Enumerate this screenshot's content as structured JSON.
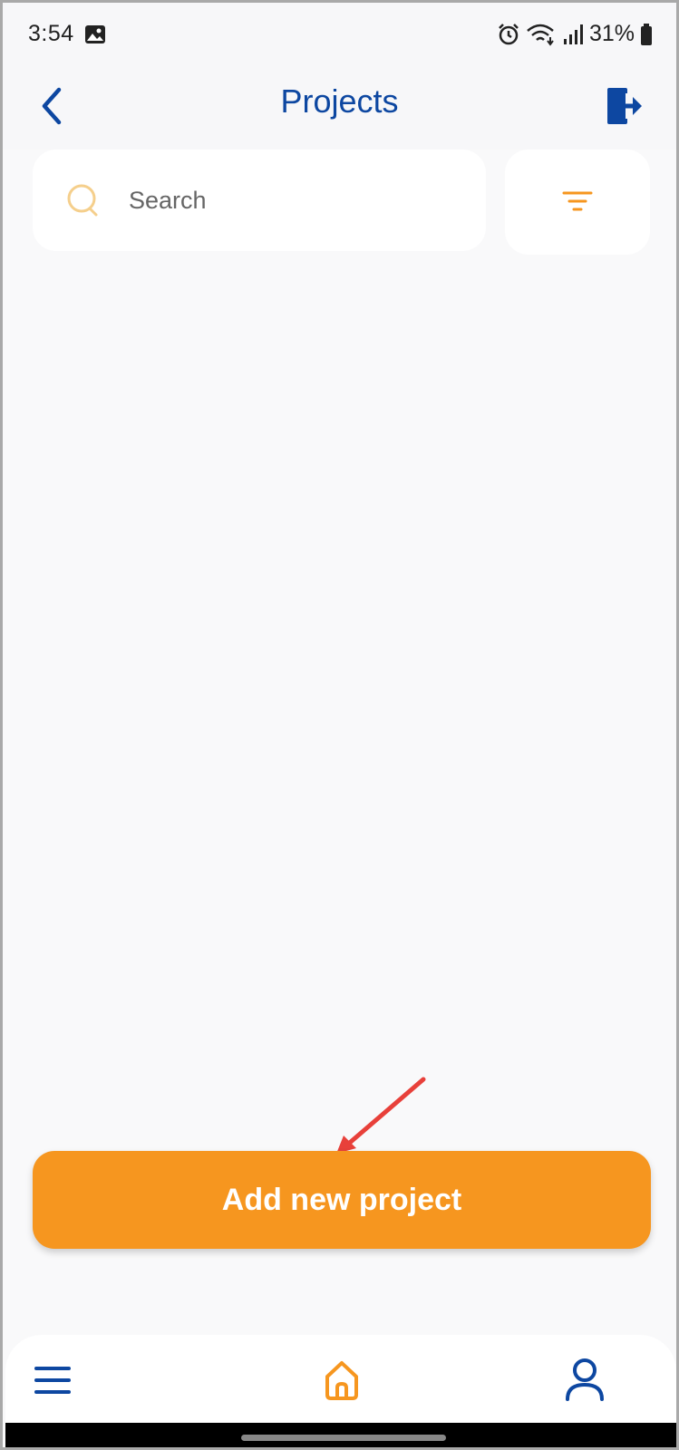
{
  "status_bar": {
    "time": "3:54",
    "battery": "31%",
    "icons": [
      "image-icon",
      "alarm-icon",
      "wifi-icon",
      "signal-icon",
      "battery-icon"
    ]
  },
  "header": {
    "title": "Projects",
    "back_icon": "chevron-left-icon",
    "logout_icon": "logout-icon"
  },
  "search": {
    "placeholder": "Search",
    "value": "",
    "icon": "search-icon"
  },
  "filter": {
    "icon": "filter-icon"
  },
  "actions": {
    "add_project_label": "Add new project"
  },
  "bottom_nav": {
    "items": [
      {
        "name": "menu",
        "icon": "menu-icon",
        "active": false
      },
      {
        "name": "home",
        "icon": "home-icon",
        "active": true
      },
      {
        "name": "profile",
        "icon": "user-icon",
        "active": false
      }
    ]
  },
  "colors": {
    "primary": "#0d47a1",
    "accent": "#f6961f",
    "background": "#f9f9fa",
    "annotation_arrow": "#e8403a"
  }
}
